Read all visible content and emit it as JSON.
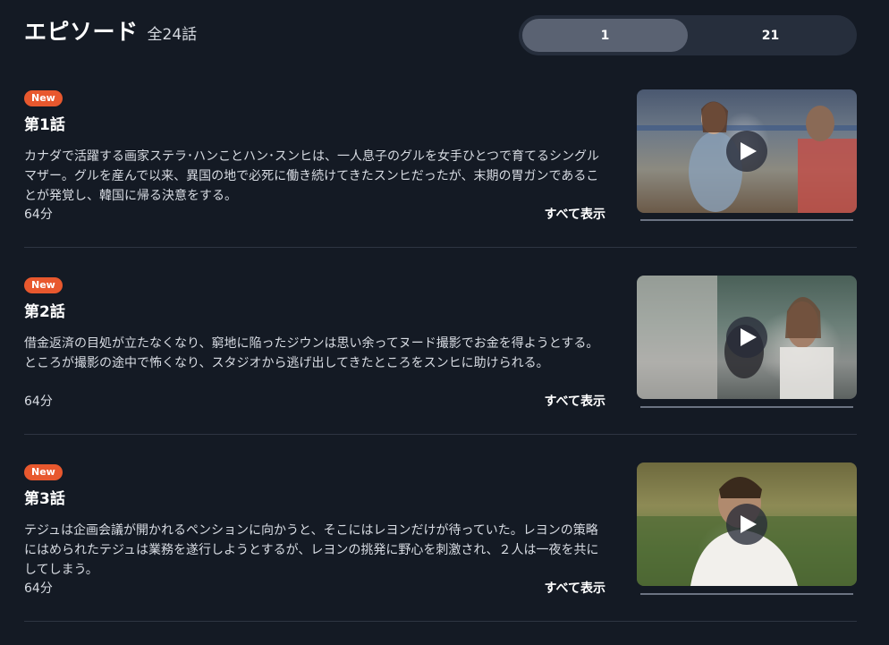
{
  "header": {
    "title": "エピソード",
    "count": "全24話"
  },
  "range_toggle": {
    "options": [
      "1",
      "21"
    ],
    "selected": "1"
  },
  "colors": {
    "background": "#141a24",
    "badge": "#e8582e",
    "toggle_active": "#5a6272"
  },
  "episodes": [
    {
      "badge": "New",
      "title": "第1話",
      "description": "カナダで活躍する画家ステラ･ハンことハン･スンヒは、一人息子のグルを女手ひとつで育てるシングルマザー。グルを産んで以来、異国の地で必死に働き続けてきたスンヒだったが、末期の胃ガンであることが発覚し、韓国に帰る決意をする。",
      "duration": "64分",
      "show_all": "すべて表示",
      "thumbnail_icon": "play-icon"
    },
    {
      "badge": "New",
      "title": "第2話",
      "description": "借金返済の目処が立たなくなり、窮地に陥ったジウンは思い余ってヌード撮影でお金を得ようとする。ところが撮影の途中で怖くなり、スタジオから逃げ出してきたところをスンヒに助けられる。",
      "duration": "64分",
      "show_all": "すべて表示",
      "thumbnail_icon": "play-icon"
    },
    {
      "badge": "New",
      "title": "第3話",
      "description": "テジュは企画会議が開かれるペンションに向かうと、そこにはレヨンだけが待っていた。レヨンの策略にはめられたテジュは業務を遂行しようとするが、レヨンの挑発に野心を刺激され、２人は一夜を共にしてしまう。",
      "duration": "64分",
      "show_all": "すべて表示",
      "thumbnail_icon": "play-icon"
    }
  ]
}
